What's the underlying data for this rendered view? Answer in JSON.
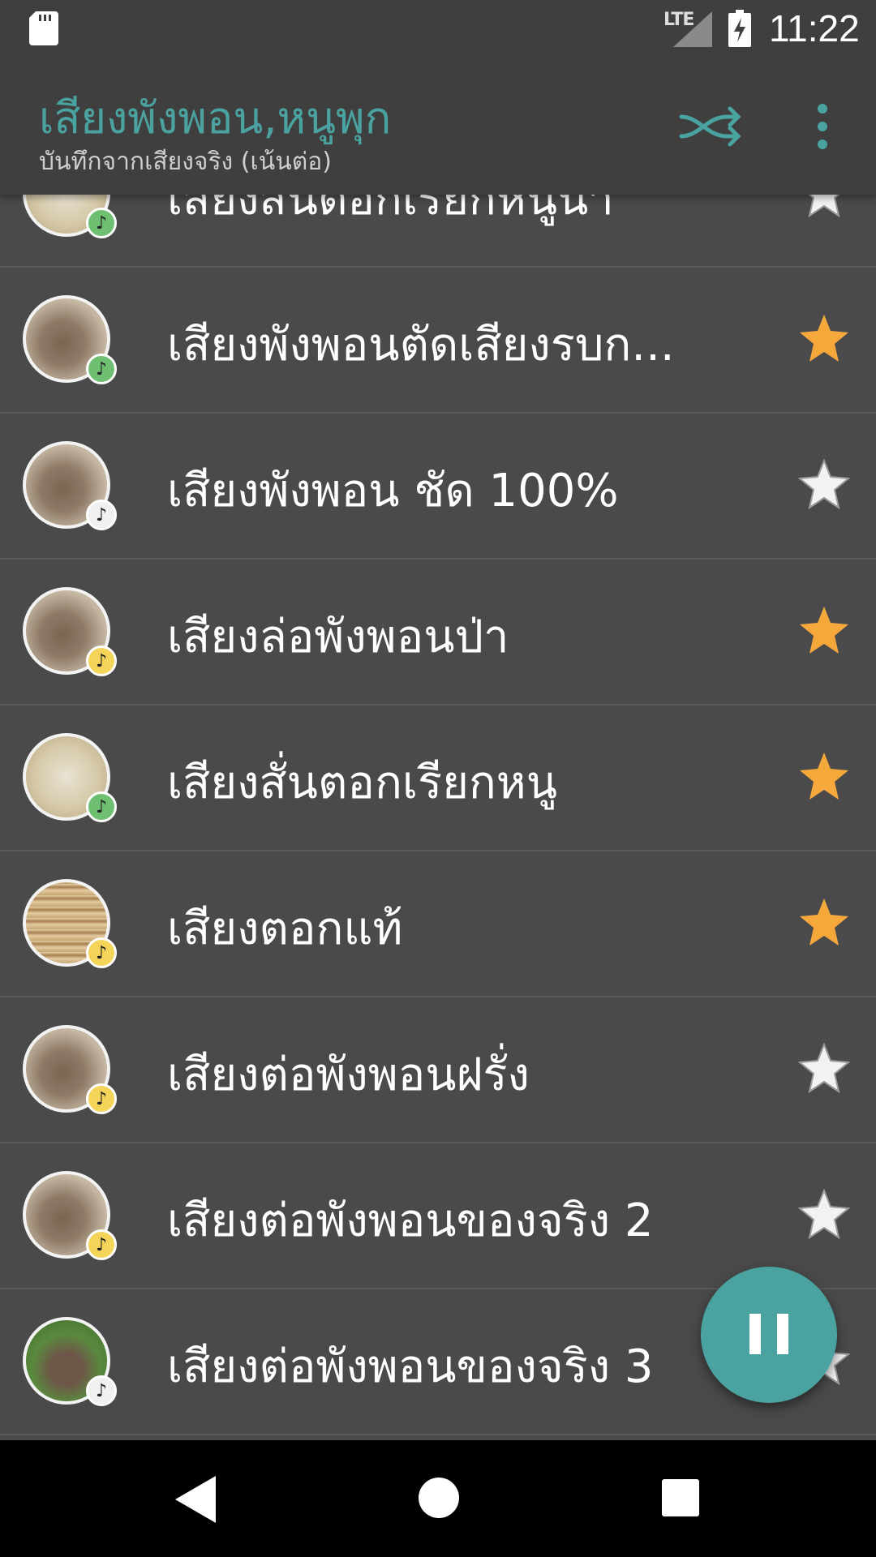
{
  "status": {
    "network": "LTE",
    "time": "11:22"
  },
  "appbar": {
    "title": "เสียงพังพอน,หนูพุก",
    "subtitle": "บันทึกจากเสียงจริง (เน้นต่อ)"
  },
  "colors": {
    "accent": "#4aa3a0",
    "star_on": "#f4a93a",
    "star_off": "#f2f2f2",
    "badge_green": "#6fbf73",
    "badge_white": "#f0f0f0",
    "badge_yellow": "#f5d45a"
  },
  "items": [
    {
      "label": "เสียงสั่นตอกเรียกหนูนา",
      "starred": false,
      "badge": "green",
      "image": "bamboo-sticks"
    },
    {
      "label": "เสียงพังพอนตัดเสียงรบก...",
      "starred": true,
      "badge": "green",
      "image": "mongoose"
    },
    {
      "label": "เสียงพังพอน ชัด 100%",
      "starred": false,
      "badge": "white",
      "image": "mongoose"
    },
    {
      "label": "เสียงล่อพังพอนป่า",
      "starred": true,
      "badge": "yellow",
      "image": "mongoose"
    },
    {
      "label": "เสียงสั่นตอกเรียกหนู",
      "starred": true,
      "badge": "green",
      "image": "bamboo-sticks"
    },
    {
      "label": "เสียงตอกแท้",
      "starred": true,
      "badge": "yellow",
      "image": "bamboo-bundle"
    },
    {
      "label": "เสียงต่อพังพอนฝรั่ง",
      "starred": false,
      "badge": "yellow",
      "image": "mongoose"
    },
    {
      "label": "เสียงต่อพังพอนของจริง 2",
      "starred": false,
      "badge": "yellow",
      "image": "mongoose"
    },
    {
      "label": "เสียงต่อพังพอนของจริง 3",
      "starred": false,
      "badge": "white",
      "image": "mongoose-grass"
    }
  ],
  "badge_glyph": "♪"
}
